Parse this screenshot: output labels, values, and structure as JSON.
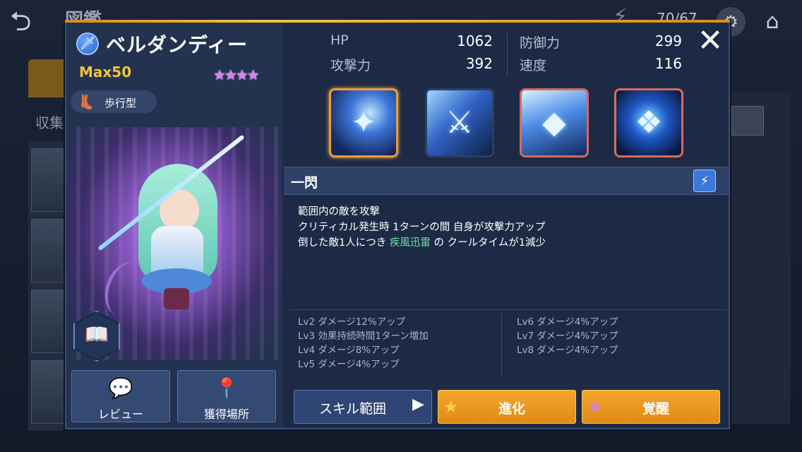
{
  "background": {
    "title": "図鑑",
    "left_label": "収集",
    "count": "70/67"
  },
  "character": {
    "name": "ベルダンディー",
    "max_level": "Max50",
    "star_count": 4,
    "stars": "★★★★",
    "type_label": "歩行型"
  },
  "stats": {
    "hp_label": "HP",
    "hp_value": "1062",
    "attack_label": "攻撃力",
    "attack_value": "392",
    "defense_label": "防御力",
    "defense_value": "299",
    "speed_label": "速度",
    "speed_value": "116"
  },
  "skills": [
    {
      "icon": "slash-skill-icon",
      "selected": true
    },
    {
      "icon": "blade-storm-skill-icon",
      "selected": false
    },
    {
      "icon": "crystal-sword-skill-icon",
      "selected": false
    },
    {
      "icon": "spirit-skill-icon",
      "selected": false
    }
  ],
  "selected_skill": {
    "name": "一閃",
    "description": [
      "範囲内の敵を攻撃",
      "クリティカル発生時 1ターンの間 自身が攻撃力アップ"
    ],
    "desc_line3_prefix": "倒した敵1人につき",
    "desc_line3_highlight": "疾風迅雷",
    "desc_line3_suffix": "の クールタイムが1減少",
    "levels_left": [
      "Lv2 ダメージ12%アップ",
      "Lv3 効果持続時間1ターン増加",
      "Lv4 ダメージ8%アップ",
      "Lv5 ダメージ4%アップ"
    ],
    "levels_right": [
      "Lv6 ダメージ4%アップ",
      "Lv7 ダメージ4%アップ",
      "Lv8 ダメージ4%アップ"
    ]
  },
  "buttons": {
    "review": "レビュー",
    "acquire": "獲得場所",
    "skill_range": "スキル範囲",
    "evolve": "進化",
    "awaken": "覚醒"
  },
  "colors": {
    "accent_orange": "#f4a62e",
    "highlight_green": "#6fe0a2",
    "star_purple": "#e07cf2",
    "max_yellow": "#f3c23e"
  }
}
